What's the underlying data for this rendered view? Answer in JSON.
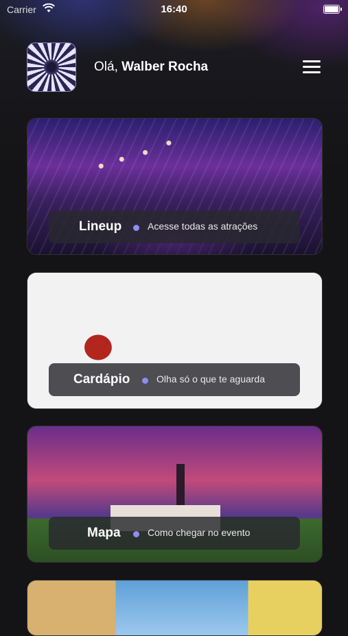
{
  "status_bar": {
    "carrier": "Carrier",
    "time": "16:40"
  },
  "header": {
    "greeting_prefix": "Olá,",
    "user_name": "Walber Rocha"
  },
  "cards": [
    {
      "title": "Lineup",
      "subtitle": "Acesse todas as atrações"
    },
    {
      "title": "Cardápio",
      "subtitle": "Olha só o que te aguarda"
    },
    {
      "title": "Mapa",
      "subtitle": "Como chegar no evento"
    }
  ],
  "colors": {
    "accent_dot": "#8c8ef0",
    "background": "#141416"
  }
}
